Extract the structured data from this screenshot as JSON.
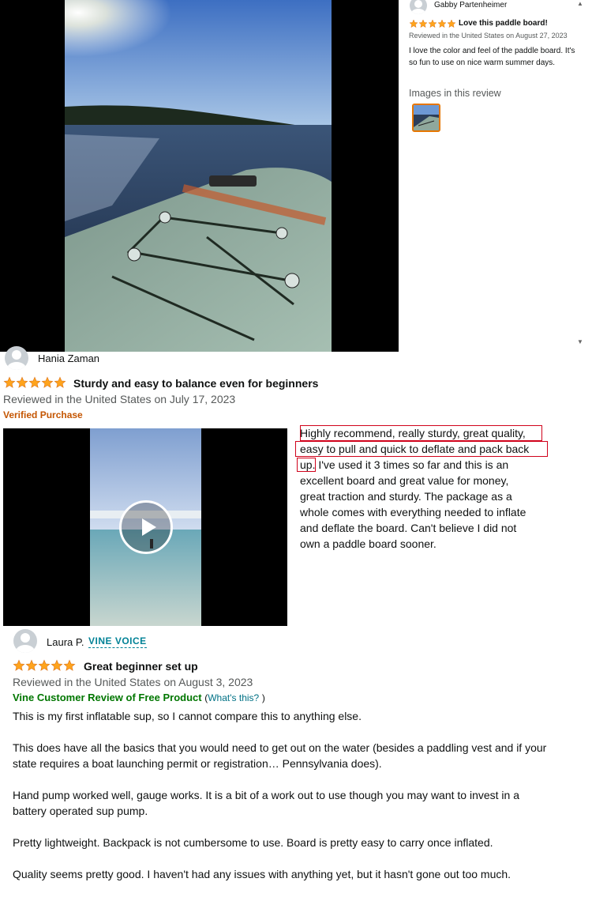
{
  "side_panel": {
    "reviewer_name": "Gabby Partenheimer",
    "rating": 5,
    "title": "Love this paddle board!",
    "date": "Reviewed in the United States on August 27, 2023",
    "body": "I love the color and feel of the paddle board. It's so fun to use on nice warm summer days.",
    "images_label": "Images in this review"
  },
  "review_1": {
    "reviewer_name": "Hania Zaman",
    "rating": 5,
    "title": "Sturdy and easy to balance even for beginners",
    "date": "Reviewed in the United States on July 17, 2023",
    "verified": "Verified Purchase",
    "body_lines": [
      "Highly recommend, really sturdy, great quality,",
      "easy to pull and quick to deflate and pack back",
      "up. I've used it 3 times so far and this is an",
      "excellent board and great value for money,",
      "great traction and sturdy. The package as a",
      "whole comes with everything needed to inflate",
      "and deflate the board. Can't believe I did not",
      "own a paddle board sooner."
    ]
  },
  "review_2": {
    "reviewer_name": "Laura P.",
    "badge": "VINE VOICE",
    "rating": 5,
    "title": "Great beginner set up",
    "date": "Reviewed in the United States on August 3, 2023",
    "vine_label": "Vine Customer Review of Free Product",
    "paren_open": "(",
    "whats_this": "What's this?",
    "paren_close": ")",
    "paragraphs": [
      "This is my first inflatable sup, so I cannot compare this to anything else.",
      "This does have all the basics that you would need to get out on the water (besides a paddling vest and if your state requires a boat launching permit or registration… Pennsylvania does).",
      "Hand pump worked well, gauge works. It is a bit of a work out to use though you may want to invest in a battery operated sup pump.",
      "Pretty lightweight. Backpack is not cumbersome to use. Board is pretty easy to carry once inflated.",
      "Quality seems pretty good. I haven't had any issues with anything yet, but it hasn't gone out too much."
    ]
  },
  "colors": {
    "star": "#ffa41c",
    "verified": "#c45500",
    "vine_badge": "#008296",
    "vine_label": "#007600",
    "link": "#007185",
    "highlight_box": "#d0021b"
  },
  "icons": [
    "star-icon",
    "play-icon",
    "user-avatar-icon",
    "scroll-up-icon",
    "scroll-down-icon"
  ]
}
